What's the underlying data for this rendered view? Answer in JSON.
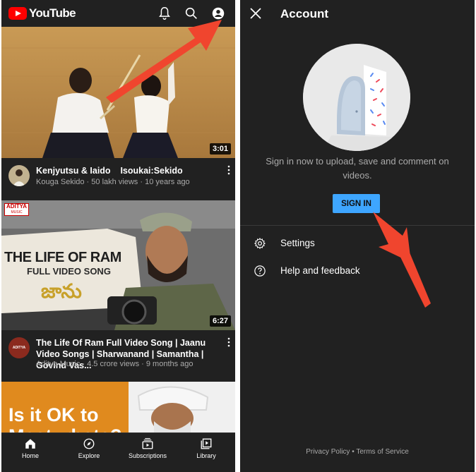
{
  "youtube_home": {
    "logo_text": "YouTube",
    "header_icons": [
      "bell-icon",
      "search-icon",
      "account-icon"
    ],
    "videos": [
      {
        "title": "Kenjyutsu & Iaido    Isoukai:Sekido",
        "meta": "Kouga Sekido · 50 lakh views · 10 years ago",
        "duration": "3:01"
      },
      {
        "title": "The Life Of Ram Full Video Song | Jaanu Video Songs | Sharwanand | Samantha | Govind Vas...",
        "meta": "Aditya Music · 4.5 crore views · 9 months ago",
        "duration": "6:27",
        "thumb_badge": "ADITYA",
        "thumb_badge_sub": "MUSIC",
        "thumb_line1": "THE LIFE OF RAM",
        "thumb_line2": "FULL VIDEO SONG",
        "thumb_telugu": "జాను",
        "avatar_text": "ADITYA"
      },
      {
        "thumb_line1": "Is it OK to",
        "thumb_line2": "Masturbate?"
      }
    ],
    "bottom_nav": [
      {
        "label": "Home",
        "icon": "home-icon"
      },
      {
        "label": "Explore",
        "icon": "compass-icon"
      },
      {
        "label": "Subscriptions",
        "icon": "subscriptions-icon"
      },
      {
        "label": "Library",
        "icon": "library-icon"
      }
    ]
  },
  "account": {
    "title": "Account",
    "prompt": "Sign in now to upload, save and comment on videos.",
    "sign_in_label": "SIGN IN",
    "menu": [
      {
        "label": "Settings",
        "icon": "gear-icon"
      },
      {
        "label": "Help and feedback",
        "icon": "help-icon"
      }
    ],
    "footer": {
      "privacy": "Privacy Policy",
      "separator": " • ",
      "terms": "Terms of Service"
    }
  },
  "colors": {
    "background": "#212121",
    "youtube_red": "#ff0000",
    "sign_in_blue": "#3ea6ff",
    "annotation_arrow": "#f0452e"
  }
}
